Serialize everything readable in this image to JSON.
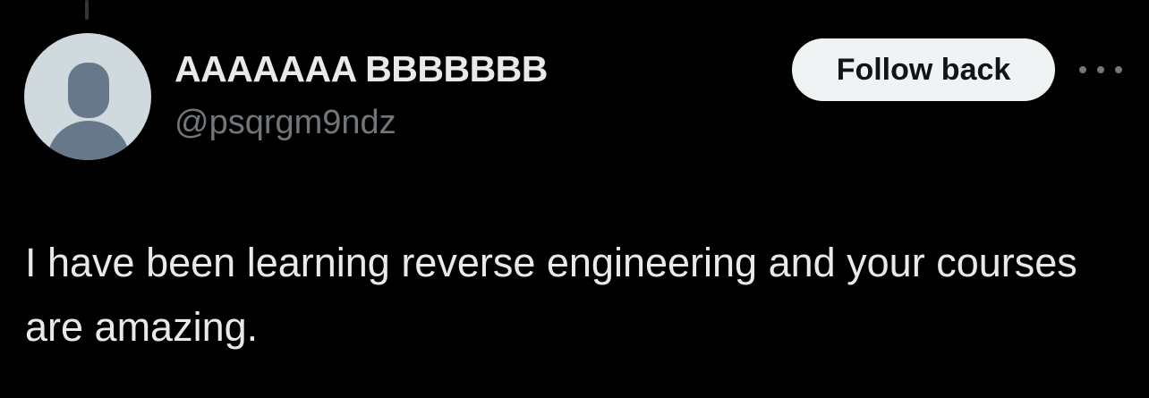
{
  "tweet": {
    "author": {
      "display_name": "AAAAAAA BBBBBBB",
      "handle": "@psqrgm9ndz",
      "avatar_icon": "default-avatar-icon"
    },
    "follow_button_label": "Follow back",
    "more_icon": "more-horizontal-icon",
    "text": "I have been learning reverse engineering and your courses are amazing."
  },
  "colors": {
    "background": "#000000",
    "primary_text": "#e7e9ea",
    "secondary_text": "#71767b",
    "button_background": "#eff3f4",
    "button_text": "#0f1419",
    "avatar_background": "#cfd9de",
    "avatar_silhouette": "#66788a"
  }
}
